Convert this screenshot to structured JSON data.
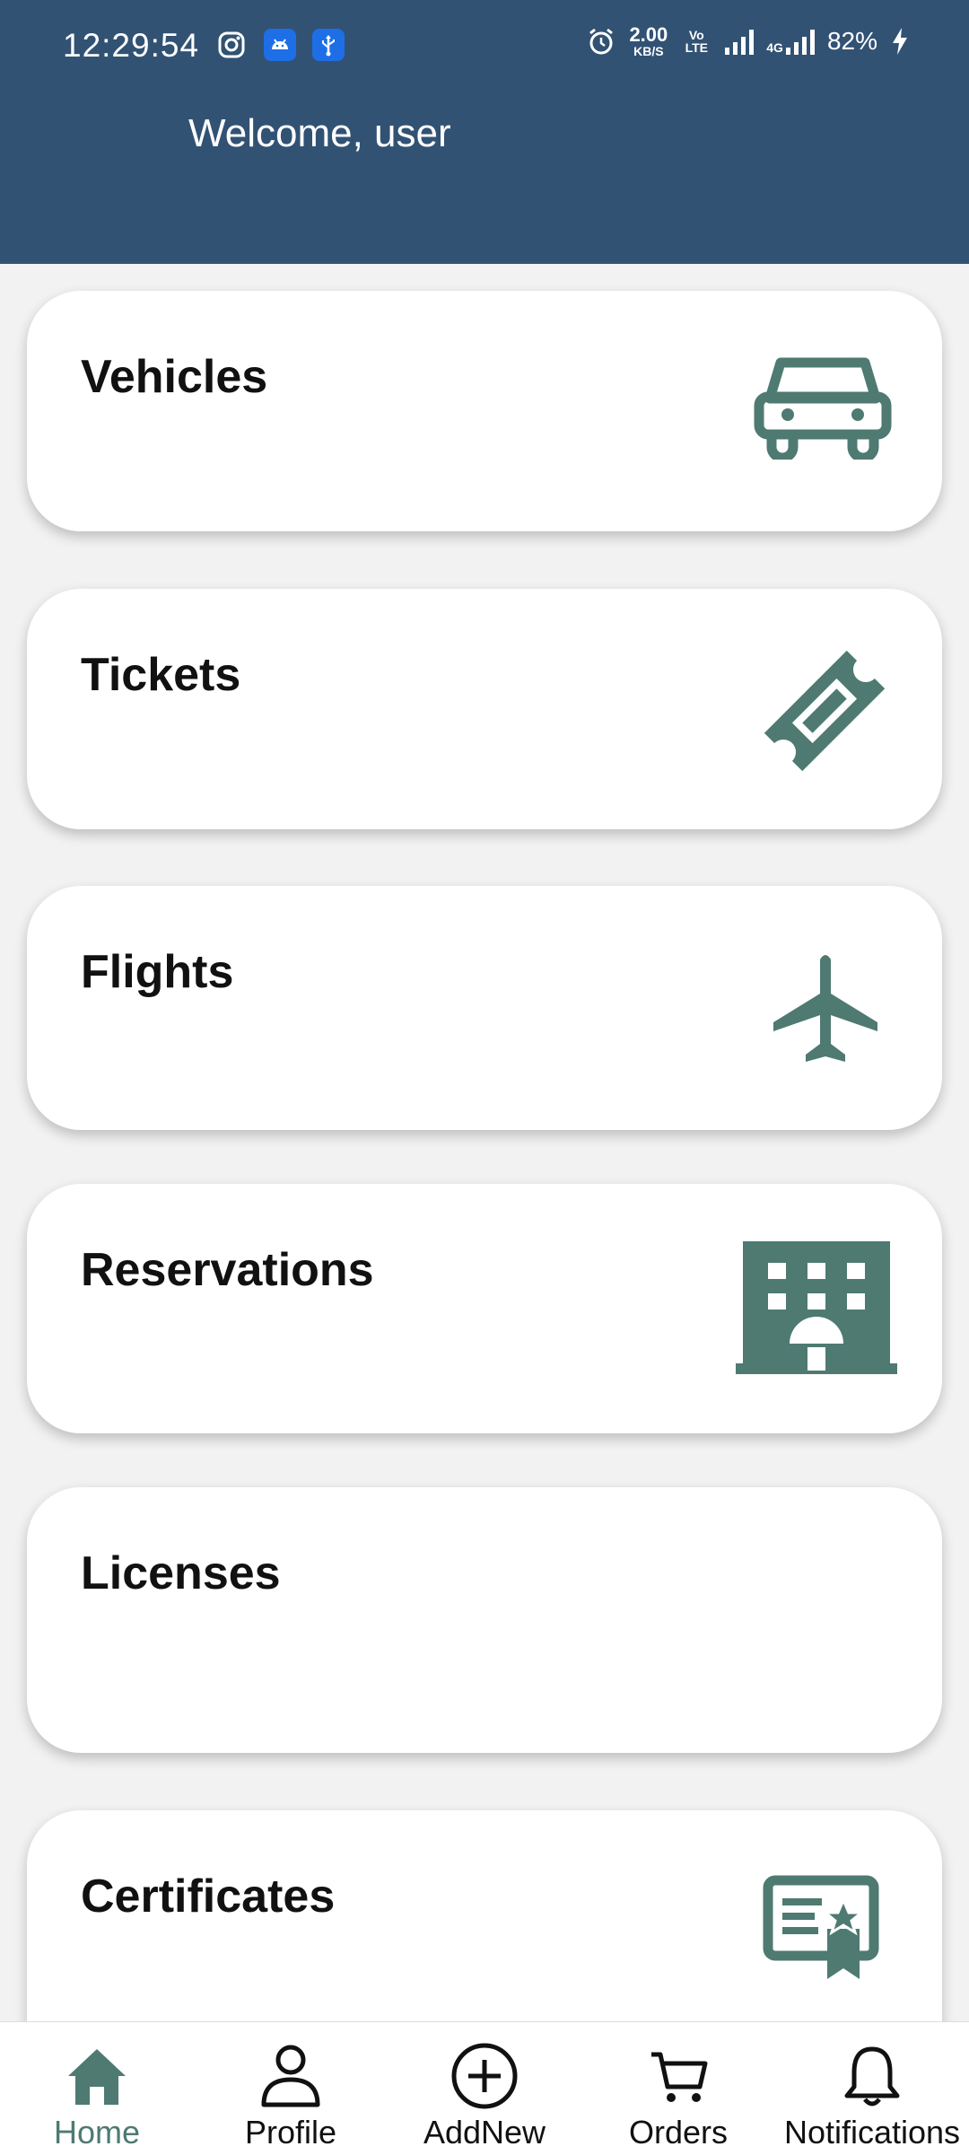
{
  "status_bar": {
    "time": "12:29:54",
    "net_speed_value": "2.00",
    "net_speed_unit": "KB/S",
    "volte_label": "Vo LTE",
    "network_type": "4G",
    "battery": "82%"
  },
  "header": {
    "welcome": "Welcome, user"
  },
  "cards": [
    {
      "title": "Vehicles",
      "icon": "car-icon"
    },
    {
      "title": "Tickets",
      "icon": "ticket-icon"
    },
    {
      "title": "Flights",
      "icon": "airplane-icon"
    },
    {
      "title": "Reservations",
      "icon": "hotel-icon"
    },
    {
      "title": "Licenses",
      "icon": ""
    },
    {
      "title": "Certificates",
      "icon": "certificate-icon"
    }
  ],
  "bottom_nav": [
    {
      "label": "Home",
      "icon": "home-icon",
      "active": true
    },
    {
      "label": "Profile",
      "icon": "person-icon",
      "active": false
    },
    {
      "label": "AddNew",
      "icon": "add-circle-icon",
      "active": false
    },
    {
      "label": "Orders",
      "icon": "cart-icon",
      "active": false
    },
    {
      "label": "Notifications",
      "icon": "bell-icon",
      "active": false
    }
  ],
  "colors": {
    "header_bg": "#325274",
    "accent": "#4e7a72",
    "page_bg": "#f2f2f2"
  }
}
